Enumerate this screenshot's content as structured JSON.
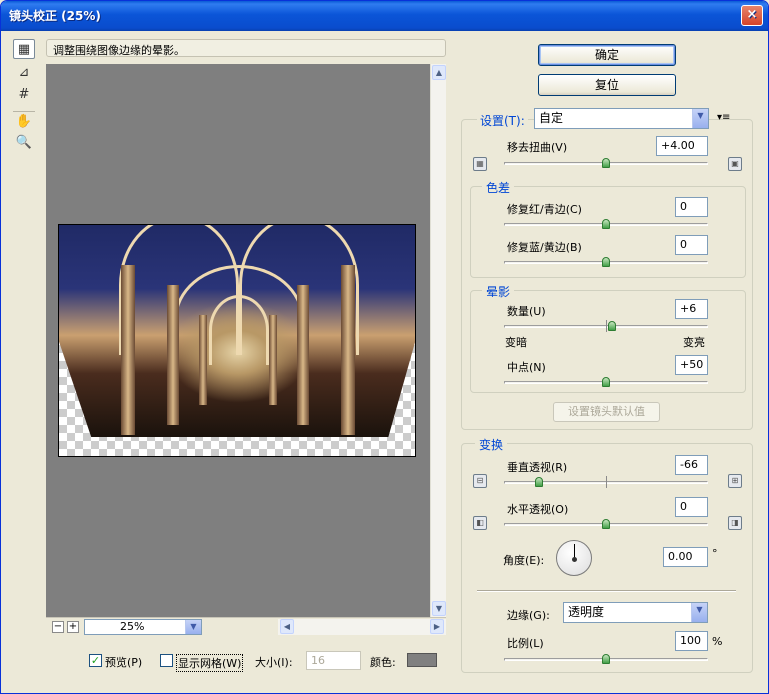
{
  "window": {
    "title": "镜头校正 (25%)",
    "close_glyph": "×"
  },
  "hint": "调整围绕图像边缘的晕影。",
  "buttons": {
    "ok": "确定",
    "reset": "复位",
    "set_default": "设置镜头默认值"
  },
  "settings": {
    "label": "设置(T):",
    "value": "自定",
    "menu_glyph": "▾≡"
  },
  "distortion": {
    "label": "移去扭曲(V)",
    "value": "+4.00",
    "fraction": 0.5
  },
  "chromatic": {
    "title": "色差",
    "red_cyan": {
      "label": "修复红/青边(C)",
      "value": "0",
      "fraction": 0.5
    },
    "blue_yellow": {
      "label": "修复蓝/黄边(B)",
      "value": "0",
      "fraction": 0.5
    }
  },
  "vignette": {
    "title": "晕影",
    "amount": {
      "label": "数量(U)",
      "value": "+6",
      "fraction": 0.53
    },
    "darken": "变暗",
    "lighten": "变亮",
    "midpoint": {
      "label": "中点(N)",
      "value": "+50",
      "fraction": 0.5
    }
  },
  "transform": {
    "title": "变换",
    "vertical": {
      "label": "垂直透视(R)",
      "value": "-66",
      "fraction": 0.17
    },
    "horizontal": {
      "label": "水平透视(O)",
      "value": "0",
      "fraction": 0.5
    },
    "angle": {
      "label": "角度(E):",
      "value": "0.00",
      "unit": "°"
    },
    "edge": {
      "label": "边缘(G):",
      "value": "透明度"
    },
    "scale": {
      "label": "比例(L)",
      "value": "100",
      "unit": "%",
      "fraction": 0.5
    }
  },
  "bottom": {
    "zoom": "25%",
    "zoom_out": "−",
    "zoom_in": "+",
    "preview_label": "预览(P)",
    "preview_checked": "✓",
    "grid_label": "显示网格(W)",
    "size_label": "大小(I):",
    "size_value": "16",
    "color_label": "颜色:"
  },
  "icons": [
    "lens-tool-icon",
    "straighten-tool-icon",
    "grid-move-tool-icon",
    "hand-tool-icon",
    "zoom-tool-icon"
  ],
  "colors": {
    "title_bar": "#0a4ccd",
    "group_label": "#0046d5",
    "slider_thumb": "#43a047"
  }
}
